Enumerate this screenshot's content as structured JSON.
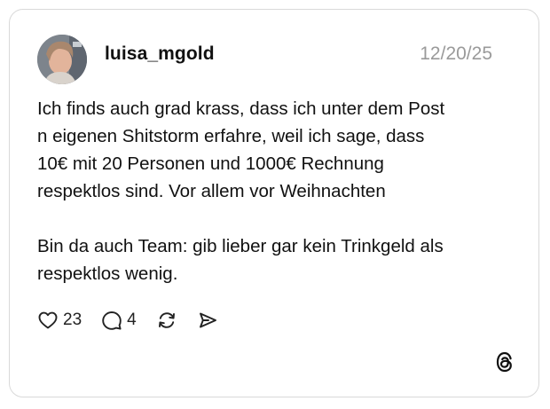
{
  "post": {
    "username": "luisa_mgold",
    "timestamp": "12/20/25",
    "paragraphs": [
      "Ich finds auch grad krass, dass ich unter dem Post\nn eigenen Shitstorm erfahre, weil ich sage, dass\n10€ mit 20 Personen und 1000€ Rechnung\nrespektlos sind. Vor allem vor Weihnachten",
      "Bin da auch Team: gib lieber gar kein Trinkgeld als\nrespektlos wenig."
    ]
  },
  "actions": {
    "like": {
      "icon": "heart-icon",
      "count": "23"
    },
    "reply": {
      "icon": "comment-icon",
      "count": "4"
    },
    "repost": {
      "icon": "repost-icon"
    },
    "share": {
      "icon": "send-icon"
    }
  },
  "branding": {
    "icon": "threads-logo-icon"
  },
  "colors": {
    "text": "#111111",
    "muted": "#9a9a9a",
    "border": "#d9d9d9",
    "background": "#ffffff"
  }
}
